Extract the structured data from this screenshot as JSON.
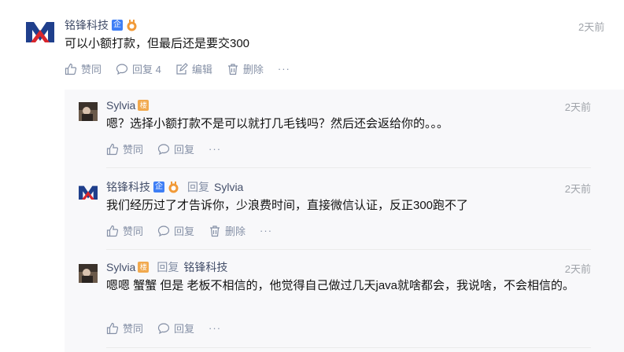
{
  "root": {
    "author": "铭锋科技",
    "badge_qi": "企",
    "time": "2天前",
    "content": "可以小额打款，但最后还是要交300",
    "actions": {
      "like": "赞同",
      "reply": "回复 4",
      "edit": "编辑",
      "delete": "删除",
      "more": "···"
    }
  },
  "replies": [
    {
      "author": "Sylvia",
      "badge_lou": "楼",
      "time": "2天前",
      "content": "嗯？选择小额打款不是可以就打几毛钱吗？然后还会返给你的。。。",
      "actions": {
        "like": "赞同",
        "reply": "回复",
        "more": "···"
      }
    },
    {
      "author": "铭锋科技",
      "badge_qi": "企",
      "reply_label": "回复",
      "reply_to": "Sylvia",
      "time": "2天前",
      "content": "我们经历过了才告诉你，少浪费时间，直接微信认证，反正300跑不了",
      "actions": {
        "like": "赞同",
        "reply": "回复",
        "delete": "删除",
        "more": "···"
      }
    },
    {
      "author": "Sylvia",
      "badge_lou": "楼",
      "reply_label": "回复",
      "reply_to": "铭锋科技",
      "time": "2天前",
      "content": "嗯嗯 蟹蟹 但是 老板不相信的，他觉得自己做过几天java就啥都会，我说啥，不会相信的。",
      "actions": {
        "like": "赞同",
        "reply": "回复",
        "more": "···"
      }
    }
  ],
  "colors": {
    "accent": "#444f6a",
    "muted": "#8590a6",
    "qi_badge": "#3e7ef5",
    "lou_badge": "#f1a94e",
    "panel": "#f8f8fa"
  }
}
